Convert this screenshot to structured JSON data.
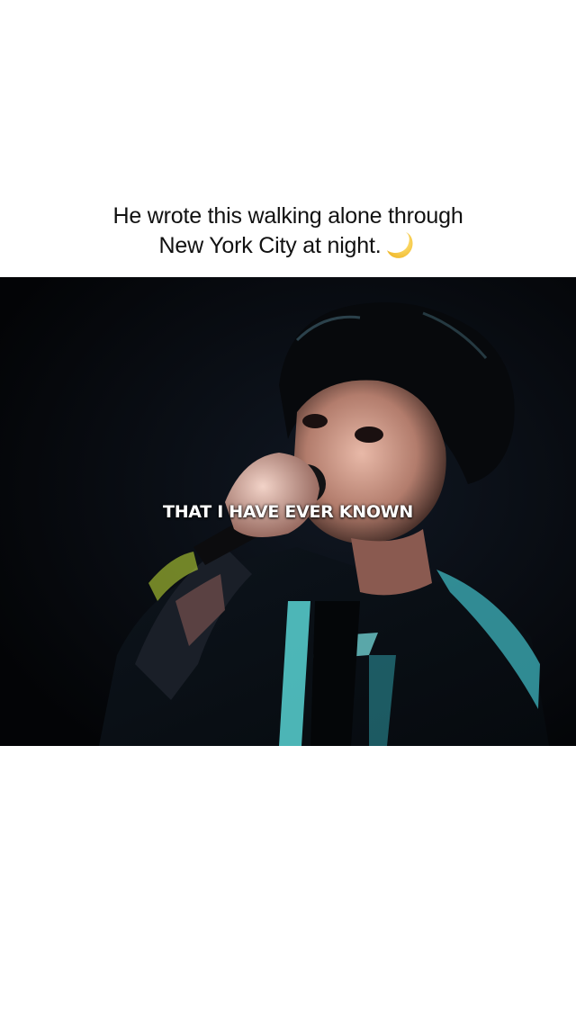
{
  "post": {
    "caption_line1": "He wrote this walking alone through",
    "caption_line2": "New York City at night.",
    "caption_emoji": "crescent-moon-icon"
  },
  "video": {
    "lyric_text": "THAT I HAVE EVER KNOWN",
    "background_color": "#05070b",
    "accent_color": "#5ee0e0"
  }
}
